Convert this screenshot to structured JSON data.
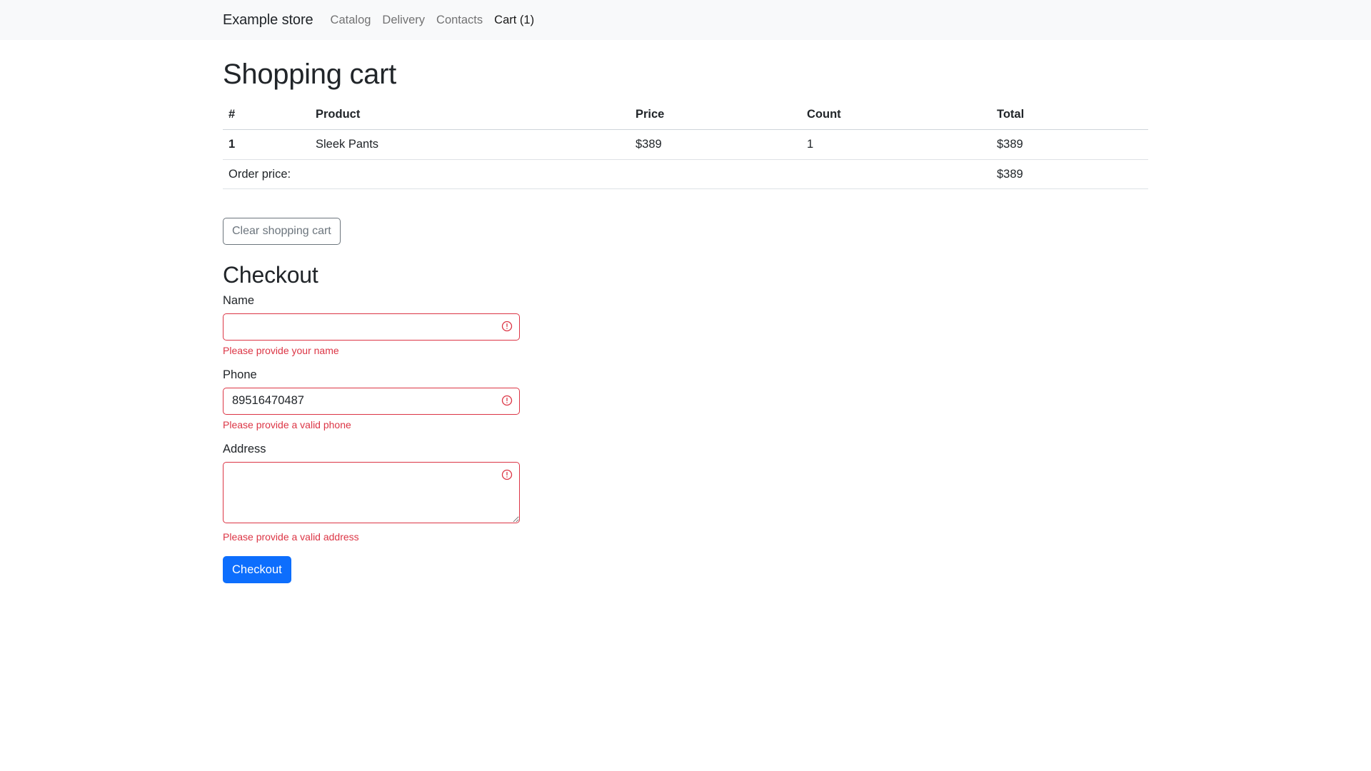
{
  "nav": {
    "brand": "Example store",
    "links": [
      {
        "label": "Catalog"
      },
      {
        "label": "Delivery"
      },
      {
        "label": "Contacts"
      },
      {
        "label": "Cart (1)"
      }
    ]
  },
  "cart": {
    "title": "Shopping cart",
    "columns": [
      "#",
      "Product",
      "Price",
      "Count",
      "Total"
    ],
    "rows": [
      {
        "num": "1",
        "product": "Sleek Pants",
        "price": "$389",
        "count": "1",
        "total": "$389"
      }
    ],
    "order_price_label": "Order price:",
    "order_price_value": "$389",
    "clear_button": "Clear shopping cart"
  },
  "checkout": {
    "title": "Checkout",
    "name": {
      "label": "Name",
      "value": "",
      "error": "Please provide your name"
    },
    "phone": {
      "label": "Phone",
      "value": "89516470487",
      "error": "Please provide a valid phone"
    },
    "address": {
      "label": "Address",
      "value": "",
      "error": "Please provide a valid address"
    },
    "submit": "Checkout"
  },
  "colors": {
    "primary": "#0d6efd",
    "danger": "#dc3545",
    "secondary": "#6c757d",
    "navbar_bg": "#f8f9fa"
  },
  "icons": {
    "field_error": "exclamation-circle-icon"
  }
}
